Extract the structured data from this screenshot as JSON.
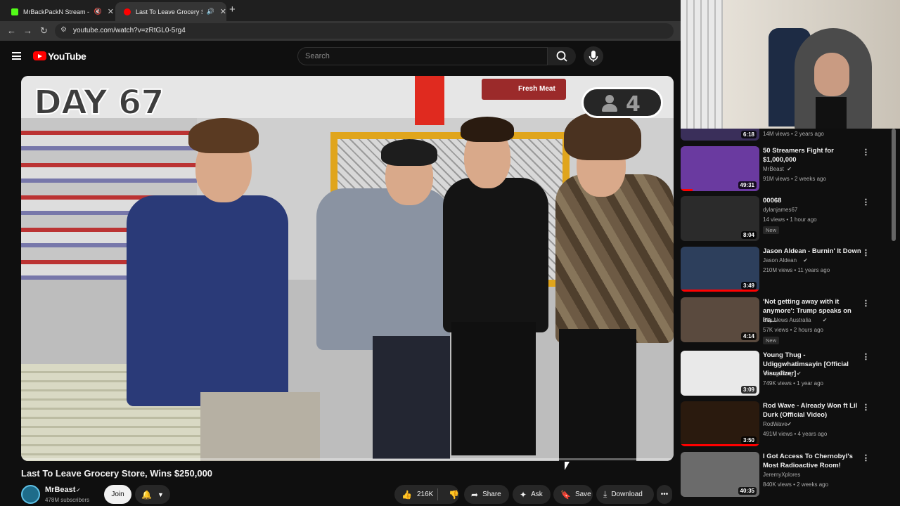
{
  "browser": {
    "tabs": [
      {
        "title": "MrBackPackN Stream - Wa",
        "icon": "kick-icon",
        "color": "#53fc18"
      },
      {
        "title": "Last To Leave Grocery Store",
        "icon": "youtube-icon",
        "color": "#ff0000"
      }
    ],
    "new_tab": "+",
    "url": "youtube.com/watch?v=zRtGL0-5rg4"
  },
  "header": {
    "logo": "YouTube",
    "search_placeholder": "Search"
  },
  "video": {
    "overlay_day": "DAY 67",
    "overlay_count": "4",
    "sign_text": "Fresh Meat",
    "title": "Last To Leave Grocery Store, Wins $250,000",
    "channel": "MrBeast",
    "subscribers": "478M subscribers",
    "join": "Join",
    "likes": "216K",
    "share": "Share",
    "ask": "Ask",
    "save": "Save",
    "download": "Download"
  },
  "recommendations": [
    {
      "title": "",
      "channel": "",
      "meta": "14M views • 2 years ago",
      "duration": "6:18",
      "thumb": "#3a2f5a",
      "partial": true
    },
    {
      "title": "50 Streamers Fight for $1,000,000",
      "channel": "MrBeast",
      "verified": true,
      "meta": "91M views • 2 weeks ago",
      "duration": "49:31",
      "thumb": "#6a3aa0",
      "watched": 0.15
    },
    {
      "title": "00068",
      "channel": "dylanjames67",
      "meta": "14 views • 1 hour ago",
      "badge": "New",
      "duration": "8:04",
      "thumb": "#2b2b2b"
    },
    {
      "title": "Jason Aldean - Burnin' It Down",
      "channel": "Jason Aldean",
      "verified": true,
      "meta": "210M views • 11 years ago",
      "duration": "3:49",
      "thumb": "#2d3f5c",
      "watched": 1.0
    },
    {
      "title": "'Not getting away with it anymore': Trump speaks on Ira...",
      "channel": "Sky News Australia",
      "verified": true,
      "meta": "57K views • 2 hours ago",
      "badge": "New",
      "duration": "4:14",
      "thumb": "#5a4a3e"
    },
    {
      "title": "Young Thug - Udiggwhatimsayin [Official Visualizer]",
      "channel": "Young Thug",
      "verified": true,
      "meta": "749K views • 1 year ago",
      "duration": "3:09",
      "thumb": "#e9e9e9"
    },
    {
      "title": "Rod Wave - Already Won ft Lil Durk (Official Video)",
      "channel": "RodWave",
      "verified": true,
      "meta": "491M views • 4 years ago",
      "duration": "3:50",
      "thumb": "#2a1a0e",
      "watched": 1.0
    },
    {
      "title": "I Got Access To Chernobyl's Most Radioactive Room!",
      "channel": "JeremyXplores",
      "meta": "840K views • 2 weeks ago",
      "duration": "40:35",
      "thumb": "#6b6b6b"
    }
  ],
  "colors": {
    "accent": "#ff0000",
    "bg": "#0f0f0f"
  }
}
